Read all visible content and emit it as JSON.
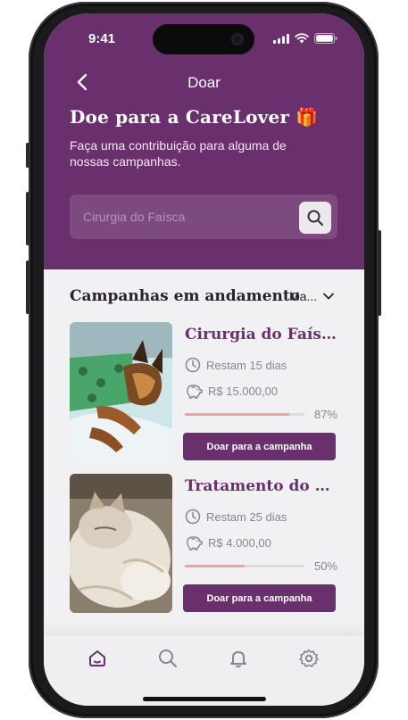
{
  "status": {
    "time": "9:41"
  },
  "nav": {
    "title": "Doar"
  },
  "header": {
    "title": "Doe para a CareLover 🎁",
    "subtitle": "Faça uma contribuição para alguma de nossas campanhas."
  },
  "search": {
    "placeholder": "Cirurgia do Faísca",
    "value": ""
  },
  "section": {
    "title": "Campanhas em andamento",
    "filter_value": "Ma..."
  },
  "campaigns": [
    {
      "name": "Cirurgia do Faísca",
      "remaining": "Restam 15 dias",
      "amount": "R$ 15.000,00",
      "progress_pct": 87,
      "progress_label": "87%",
      "button": "Doar para a campanha"
    },
    {
      "name": "Tratamento do Ch...",
      "remaining": "Restam 25 dias",
      "amount": "R$ 4.000,00",
      "progress_pct": 50,
      "progress_label": "50%",
      "button": "Doar para a campanha"
    }
  ],
  "tabs": [
    {
      "icon": "home-icon",
      "active": true
    },
    {
      "icon": "search-icon",
      "active": false
    },
    {
      "icon": "bell-icon",
      "active": false
    },
    {
      "icon": "gear-icon",
      "active": false
    }
  ],
  "colors": {
    "brand": "#6a2f6d",
    "progress": "#f2a19b",
    "background": "#f1f0f2"
  }
}
